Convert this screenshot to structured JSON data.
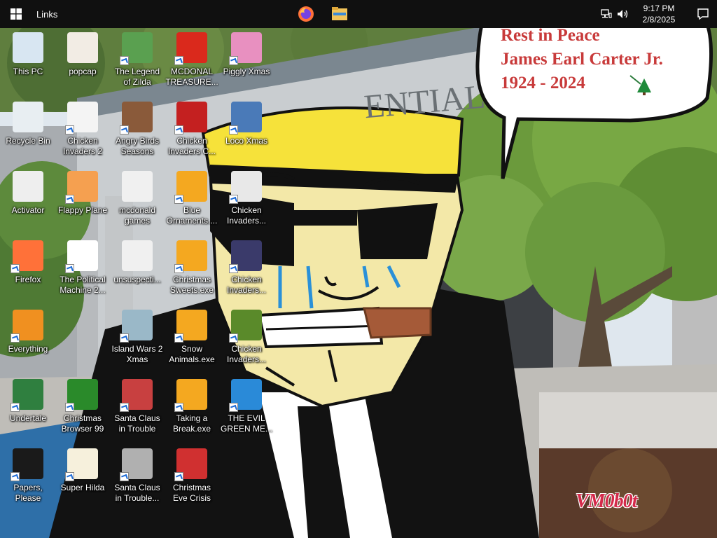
{
  "taskbar": {
    "links_label": "Links",
    "pinned": [
      {
        "name": "firefox",
        "icon": "firefox-icon"
      },
      {
        "name": "file-explorer",
        "icon": "folder-icon"
      }
    ],
    "tray": {
      "network_icon": "network-icon",
      "volume_icon": "speaker-icon",
      "time": "9:17 PM",
      "date": "2/8/2025",
      "notifications_icon": "notification-icon"
    }
  },
  "wallpaper": {
    "speech_bubble": {
      "line1": "Rest in Peace",
      "line2": "James Earl Carter Jr.",
      "line3": "1924 - 2024"
    },
    "signature": "VM0b0t",
    "building_sign": "ENTIAL"
  },
  "desktop_icons": [
    {
      "label": "This PC",
      "icon": "computer-icon",
      "color": "#d8e6f2",
      "shortcut": false
    },
    {
      "label": "Recycle Bin",
      "icon": "recycle-bin-icon",
      "color": "#e8eef2",
      "shortcut": false
    },
    {
      "label": "Activator",
      "icon": "file-icon",
      "color": "#eeeeee",
      "shortcut": false
    },
    {
      "label": "Firefox",
      "icon": "firefox-icon",
      "color": "#ff7139",
      "shortcut": true
    },
    {
      "label": "Everything",
      "icon": "magnifier-icon",
      "color": "#f09020",
      "shortcut": true
    },
    {
      "label": "Undertale",
      "icon": "undertale-icon",
      "color": "#2f7f3f",
      "shortcut": true
    },
    {
      "label": "Papers, Please",
      "icon": "papers-please-icon",
      "color": "#1a1a1a",
      "shortcut": true
    },
    {
      "label": "popcap",
      "icon": "popcap-icon",
      "color": "#f2ece4",
      "shortcut": false
    },
    {
      "label": "Chicken Invaders 2",
      "icon": "chicken-invaders-icon",
      "color": "#f4f4f4",
      "shortcut": true
    },
    {
      "label": "Flappy Plane",
      "icon": "flappy-plane-icon",
      "color": "#f5a050",
      "shortcut": true
    },
    {
      "label": "The Political Machine 2...",
      "icon": "political-machine-icon",
      "color": "#ffffff",
      "shortcut": true
    },
    {
      "label": "Christmas Browser 99",
      "icon": "christmas-tree-icon",
      "color": "#2a8a2a",
      "shortcut": true
    },
    {
      "label": "Super Hilda",
      "icon": "pixel-game-icon",
      "color": "#f6f0dc",
      "shortcut": true
    },
    {
      "label": "The Legend of Zilda",
      "icon": "zilda-icon",
      "color": "#5aa050",
      "shortcut": true
    },
    {
      "label": "Angry Birds Seasons",
      "icon": "angry-birds-icon",
      "color": "#8a5a3a",
      "shortcut": true
    },
    {
      "label": "mcdonald games",
      "icon": "folder-files-icon",
      "color": "#f0f0f0",
      "shortcut": false
    },
    {
      "label": "unsuspecti...",
      "icon": "folder-files-icon",
      "color": "#f0f0f0",
      "shortcut": false
    },
    {
      "label": "Island Wars 2 Xmas",
      "icon": "island-wars-icon",
      "color": "#9ab8c8",
      "shortcut": true
    },
    {
      "label": "Santa Claus in Trouble",
      "icon": "santa-icon",
      "color": "#c84040",
      "shortcut": true
    },
    {
      "label": "Santa Claus in Trouble... A...",
      "icon": "santa-icon",
      "color": "#b0b0b0",
      "shortcut": true
    },
    {
      "label": "MCDONAL TREASURE...",
      "icon": "mcdonalds-icon",
      "color": "#da291c",
      "shortcut": true
    },
    {
      "label": "Chicken Invaders C...",
      "icon": "chicken-invaders-icon",
      "color": "#c42020",
      "shortcut": true
    },
    {
      "label": "Blue Ornaments....",
      "icon": "puzzle-icon",
      "color": "#f4a820",
      "shortcut": true
    },
    {
      "label": "Christmas Sweets.exe",
      "icon": "puzzle-icon",
      "color": "#f4a820",
      "shortcut": true
    },
    {
      "label": "Snow Animals.exe",
      "icon": "puzzle-icon",
      "color": "#f4a820",
      "shortcut": true
    },
    {
      "label": "Taking a Break.exe",
      "icon": "puzzle-icon",
      "color": "#f4a820",
      "shortcut": true
    },
    {
      "label": "Christmas Eve Crisis",
      "icon": "santa-icon",
      "color": "#d03030",
      "shortcut": true
    },
    {
      "label": "Piggly Xmas",
      "icon": "pig-icon",
      "color": "#e890c0",
      "shortcut": true
    },
    {
      "label": "Loco Xmas",
      "icon": "teddy-bear-icon",
      "color": "#4a7ab8",
      "shortcut": true
    },
    {
      "label": "Chicken Invaders...",
      "icon": "chicken-invaders-icon",
      "color": "#e8e8e8",
      "shortcut": true
    },
    {
      "label": "Chicken Invaders...",
      "icon": "chicken-invaders-icon",
      "color": "#3a3a6a",
      "shortcut": true
    },
    {
      "label": "Chicken Invaders...",
      "icon": "chicken-invaders-icon",
      "color": "#5a8a2a",
      "shortcut": true
    },
    {
      "label": "THE EVIL GREEN ME...",
      "icon": "messenger-icon",
      "color": "#2a8ad8",
      "shortcut": true
    }
  ]
}
